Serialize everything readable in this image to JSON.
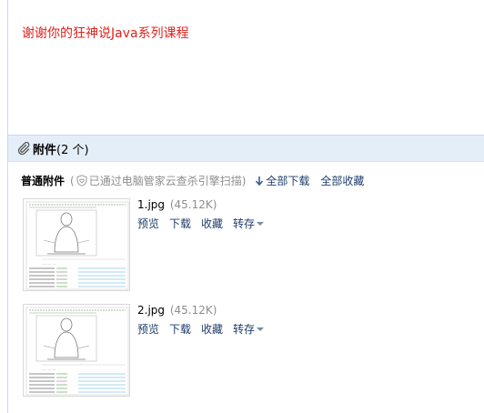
{
  "message": {
    "text": "谢谢你的狂神说Java系列课程"
  },
  "attachments": {
    "title": "附件",
    "count_text": "(2 个)",
    "section_label": "普通附件",
    "paren_open": "(",
    "scan_text": "已通过电脑管家云查杀引擎扫描",
    "paren_close": ")",
    "download_all": "全部下载",
    "save_all": "全部收藏",
    "files": [
      {
        "name": "1.jpg",
        "size": "(45.12K)",
        "actions": [
          "预览",
          "下载",
          "收藏",
          "转存"
        ]
      },
      {
        "name": "2.jpg",
        "size": "(45.12K)",
        "actions": [
          "预览",
          "下载",
          "收藏",
          "转存"
        ]
      }
    ]
  },
  "colors": {
    "message_text": "#e0221c",
    "header_bg": "#e4eef9",
    "link": "#1e3d6b",
    "muted": "#8e8e8e"
  },
  "icons": {
    "attachment": "paperclip-icon",
    "scan": "shield-heart-icon",
    "download": "down-arrow-icon",
    "more": "caret-down-icon"
  }
}
